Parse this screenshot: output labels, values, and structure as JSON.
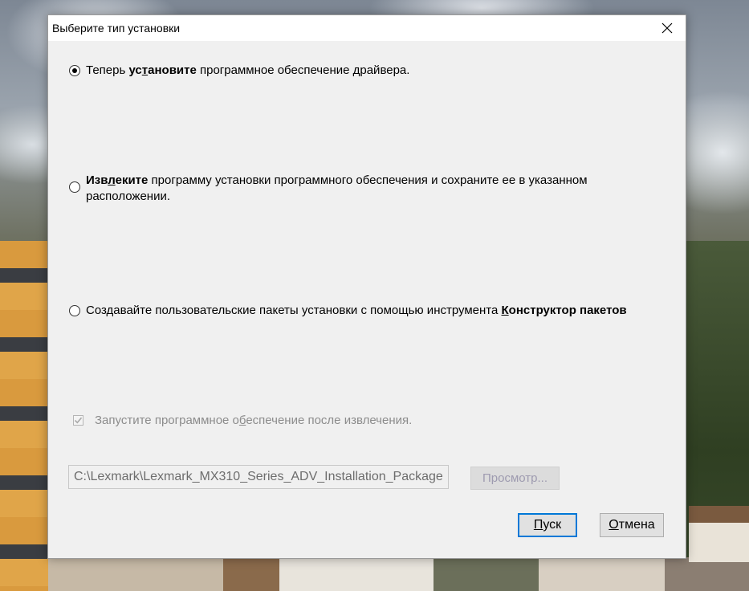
{
  "window": {
    "title": "Выберите тип установки",
    "close_icon": "close-icon"
  },
  "options": [
    {
      "selected": true,
      "pre": "Теперь ",
      "bold_a": "ус",
      "bold_u": "т",
      "bold_b": "ановите",
      "post": " программное обеспечение драйвера."
    },
    {
      "selected": false,
      "bold_a": "Изв",
      "bold_u": "л",
      "bold_b": "еките",
      "post": " программу установки программного обеспечения и сохраните ее в указанном расположении."
    },
    {
      "selected": false,
      "pre": "Создавайте пользовательские пакеты установки с помощью инструмента ",
      "bold_u": "К",
      "bold_b": "онструктор пакетов"
    }
  ],
  "run_after": {
    "checked": true,
    "enabled": false,
    "label_a": "Запустите программное о",
    "label_u": "б",
    "label_b": "еспечение после извлечения."
  },
  "path": {
    "value": "C:\\Lexmark\\Lexmark_MX310_Series_ADV_Installation_Package"
  },
  "buttons": {
    "browse": "Просмотр...",
    "start_u": "П",
    "start_rest": "уск",
    "cancel_u": "О",
    "cancel_rest": "тмена"
  }
}
